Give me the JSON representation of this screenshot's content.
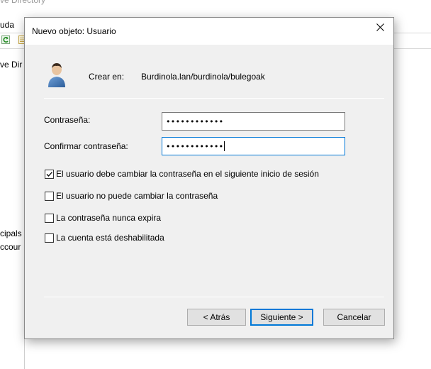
{
  "background_window": {
    "title_fragment": "ve Directory",
    "menu_fragment": "uda",
    "tree_item_top": "ve Dir",
    "tree_item_principals": "cipals",
    "tree_item_accounts": "ccour"
  },
  "dialog": {
    "title": "Nuevo objeto: Usuario",
    "close_glyph": "✕",
    "create_in_label": "Crear en:",
    "create_in_path": "Burdinola.lan/burdinola/bulegoak",
    "password_label": "Contraseña:",
    "password_value": "••••••••••••",
    "confirm_label": "Confirmar contraseña:",
    "confirm_value": "••••••••••••",
    "options": [
      {
        "label": "El usuario debe cambiar la contraseña en el siguiente inicio de sesión",
        "checked": true
      },
      {
        "label": "El usuario no puede cambiar la contraseña",
        "checked": false
      },
      {
        "label": "La contraseña nunca expira",
        "checked": false
      },
      {
        "label": "La cuenta está deshabilitada",
        "checked": false
      }
    ],
    "buttons": {
      "back": "< Atrás",
      "next": "Siguiente >",
      "cancel": "Cancelar"
    }
  },
  "icons": {
    "user": "user-icon",
    "refresh": "refresh-icon",
    "list": "list-icon"
  },
  "colors": {
    "focus_accent": "#0078d7",
    "dialog_bg": "#f0f0f0"
  }
}
